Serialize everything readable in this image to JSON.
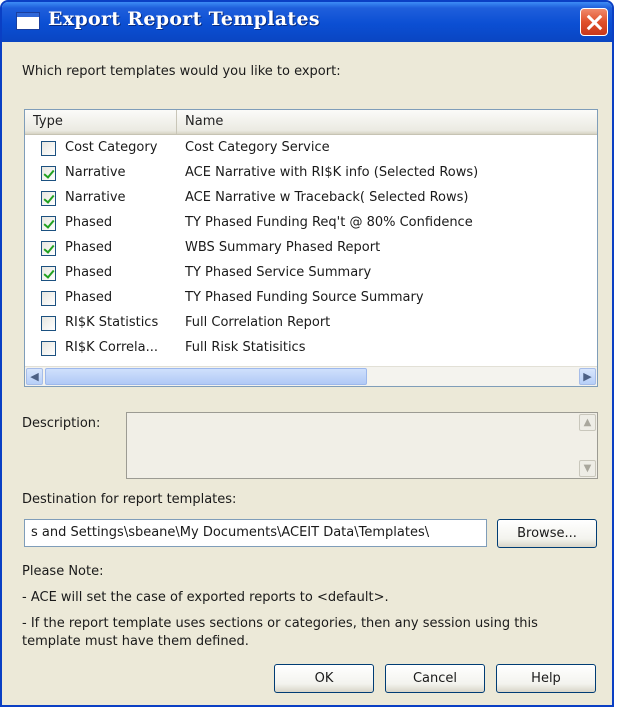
{
  "window": {
    "title": "Export Report Templates"
  },
  "prompt": "Which report templates would you like to export:",
  "list": {
    "columns": {
      "type": "Type",
      "name": "Name"
    },
    "rows": [
      {
        "checked": false,
        "type": "Cost Category",
        "name": "Cost Category Service"
      },
      {
        "checked": true,
        "type": "Narrative",
        "name": "ACE Narrative with RI$K info (Selected Rows)"
      },
      {
        "checked": true,
        "type": "Narrative",
        "name": "ACE Narrative w Traceback( Selected Rows)"
      },
      {
        "checked": true,
        "type": "Phased",
        "name": "TY Phased Funding Req't @ 80% Confidence"
      },
      {
        "checked": true,
        "type": "Phased",
        "name": "WBS Summary Phased Report"
      },
      {
        "checked": true,
        "type": "Phased",
        "name": "TY Phased Service Summary"
      },
      {
        "checked": false,
        "type": "Phased",
        "name": "TY Phased Funding Source Summary"
      },
      {
        "checked": false,
        "type": "RI$K Statistics",
        "name": "Full  Correlation Report"
      },
      {
        "checked": false,
        "type": "RI$K Correla...",
        "name": "Full Risk Statisitics"
      }
    ]
  },
  "description": {
    "label": "Description:",
    "value": ""
  },
  "destination": {
    "label": "Destination for report templates:",
    "value": "s and Settings\\sbeane\\My Documents\\ACEIT Data\\Templates\\",
    "browse_label": "Browse..."
  },
  "notes": {
    "heading": "Please Note:",
    "line1": "- ACE will set the case of exported reports to <default>.",
    "line2a": "- If the report template uses sections or categories, then any session using this",
    "line2b": "template must have them defined."
  },
  "buttons": {
    "ok": "OK",
    "cancel": "Cancel",
    "help": "Help"
  }
}
